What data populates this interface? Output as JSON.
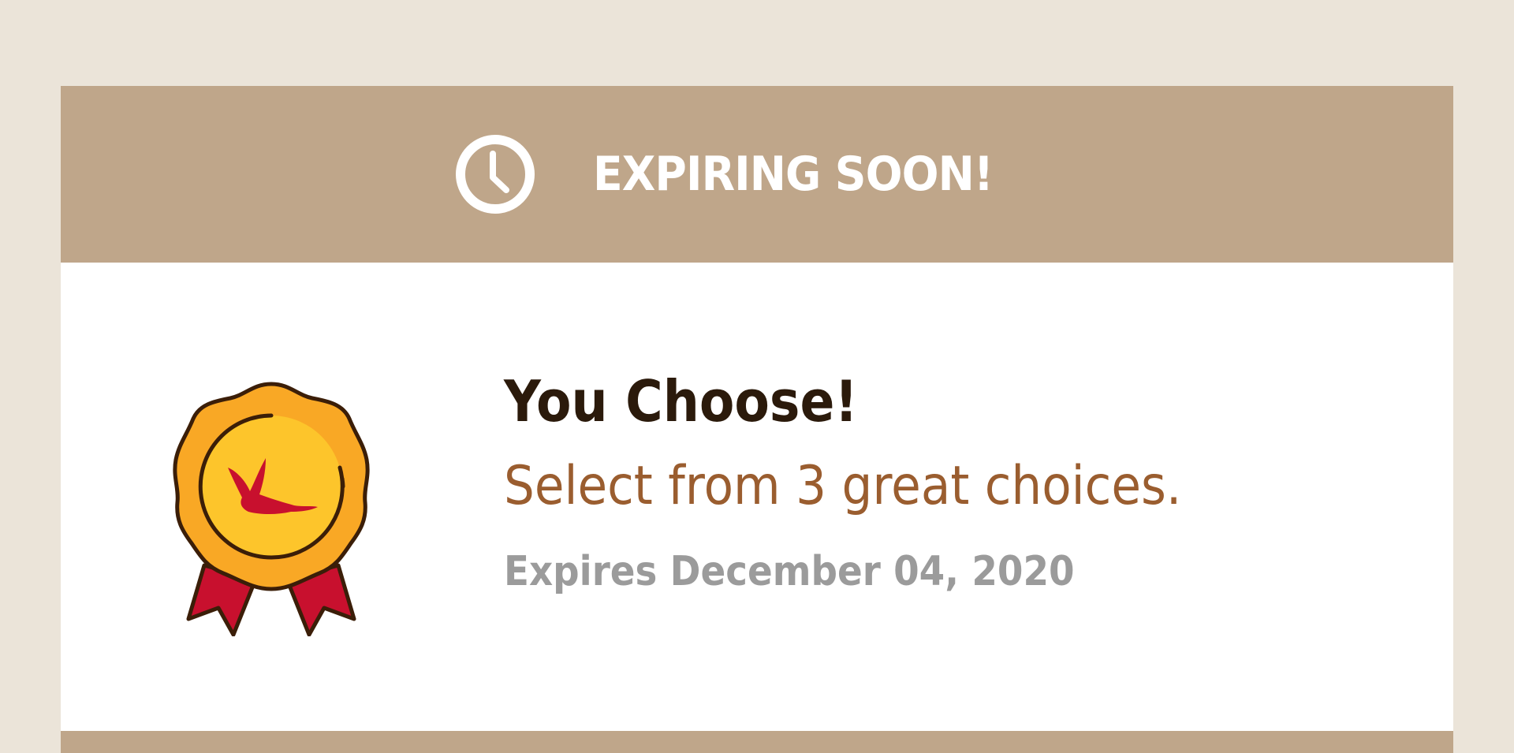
{
  "banner": {
    "icon": "clock-icon",
    "title": "EXPIRING SOON!"
  },
  "offer": {
    "icon": "award-badge-icon",
    "title": "You Choose!",
    "subtitle": "Select from 3 great choices.",
    "expiry": "Expires December 04, 2020"
  },
  "colors": {
    "page_background": "#ebe4d9",
    "banner_background": "#bfa68a",
    "card_background": "#ffffff",
    "title_text": "#2b1a0b",
    "subtitle_text": "#9a5d2f",
    "expiry_text": "#9b9b9b",
    "badge_outer": "#f9a825",
    "badge_inner": "#fdc52b",
    "ribbon": "#c8102e",
    "outline": "#3b1e08"
  }
}
